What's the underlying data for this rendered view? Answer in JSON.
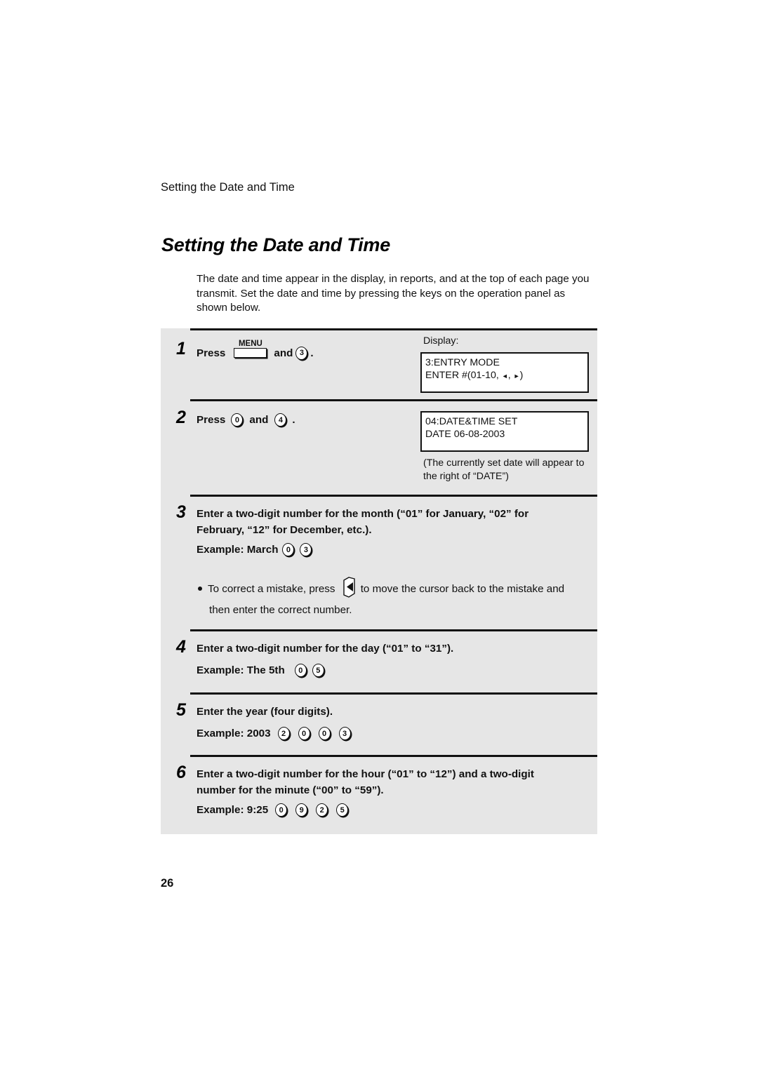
{
  "header": {
    "running_title": "Setting the Date and Time"
  },
  "page_title": "Setting the Date and Time",
  "intro": "The date and time appear in the display, in reports, and at the top of each page you transmit. Set the date and time by pressing the keys on the operation panel as shown below.",
  "display_label": "Display:",
  "steps": [
    {
      "number": "1",
      "press_label": "Press",
      "menu_key": "MENU",
      "and_label": "and",
      "key": "3",
      "end": ".",
      "display": {
        "line1": "3:ENTRY MODE",
        "line2_prefix": "ENTER #(01-10,",
        "left_arrow": "◄",
        "sep": ",",
        "right_arrow": "►",
        "close": ")"
      }
    },
    {
      "number": "2",
      "press_label": "Press",
      "key1": "0",
      "and_label": "and",
      "key2": "4",
      "end": ".",
      "display": {
        "line1": "04:DATE&TIME SET",
        "line2": "DATE 06-08-2003"
      },
      "note": "(The currently set date will appear to the right of “DATE”)"
    },
    {
      "number": "3",
      "text_line1": "Enter a two-digit number for the month (“01” for January, “02” for",
      "text_line2": "February, “12” for December, etc.).",
      "example_label": "Example: March",
      "keys": [
        "0",
        "3"
      ],
      "bullet_before": "To correct a mistake, press",
      "bullet_after": "to move the cursor back to the mistake and",
      "bullet_line2": "then enter the correct number.",
      "back_key_icon": "left-arrow-key"
    },
    {
      "number": "4",
      "text_line1": "Enter a two-digit number for the day (“01” to “31”).",
      "example_label": "Example: The 5th",
      "keys": [
        "0",
        "5"
      ]
    },
    {
      "number": "5",
      "text_line1": "Enter the year (four digits).",
      "example_label": "Example: 2003",
      "keys": [
        "2",
        "0",
        "0",
        "3"
      ]
    },
    {
      "number": "6",
      "text_line1": "Enter a two-digit number for the hour (“01” to “12”) and a two-digit",
      "text_line2": "number for the minute (“00” to “59”).",
      "example_label": "Example: 9:25",
      "keys": [
        "0",
        "9",
        "2",
        "5"
      ]
    }
  ],
  "page_number": "26"
}
